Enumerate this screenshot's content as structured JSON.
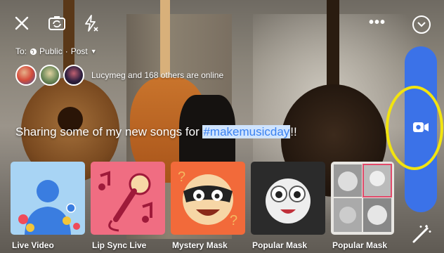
{
  "top_bar": {
    "close_icon": "close-icon",
    "flip_icon": "camera-flip-icon",
    "flash_icon": "flash-off-icon",
    "more_label": "•••",
    "collapse_icon": "chevron-down-icon"
  },
  "audience": {
    "prefix": "To:",
    "privacy": "Public",
    "separator": "·",
    "destination": "Post",
    "dropdown_icon": "caret-down-icon"
  },
  "online": {
    "text": "Lucymeg and 168 others are online"
  },
  "caption": {
    "before": "Sharing some of my new songs for ",
    "hashtag": "#makemusicday",
    "after": "!!"
  },
  "go_live": {
    "icon": "video-camera-icon",
    "color": "#3b72e8"
  },
  "effects": [
    {
      "label": "Live Video"
    },
    {
      "label": "Lip Sync Live"
    },
    {
      "label": "Mystery Mask"
    },
    {
      "label": "Popular Mask"
    },
    {
      "label": "Popular Mask"
    }
  ],
  "magic_icon": "magic-wand-icon",
  "colors": {
    "highlight": "#f2e40f",
    "hashtag_bg": "#cfe4ff"
  }
}
